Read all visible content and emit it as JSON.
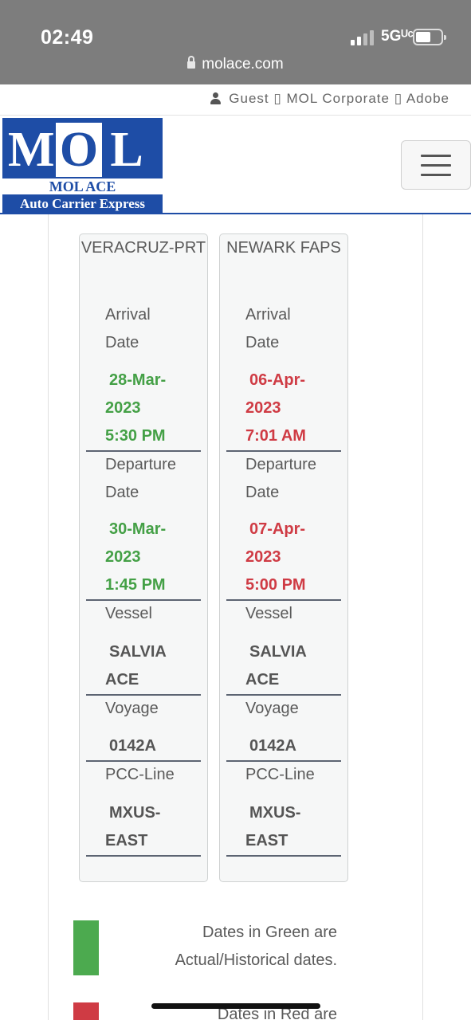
{
  "status_bar": {
    "time": "02:49",
    "network": "5Gᵁᶜ",
    "url": "molace.com"
  },
  "top_links": {
    "text": "Guest ▯ MOL Corporate ▯ Adobe"
  },
  "logo": {
    "letters": [
      "M",
      "O",
      "L"
    ],
    "subtitle": "MOL ACE",
    "tagline": "Auto Carrier Express",
    "brand_color": "#1e4da6"
  },
  "ports": [
    {
      "name": "VERACRUZ-PRT",
      "arrival_label": "Arrival Date",
      "arrival": [
        "28-Mar-",
        "2023",
        "5:30 PM"
      ],
      "arrival_color": "green",
      "departure_label": "Departure Date",
      "departure": [
        "30-Mar-",
        "2023",
        "1:45 PM"
      ],
      "departure_color": "green",
      "vessel_label": "Vessel",
      "vessel": [
        "SALVIA",
        "ACE"
      ],
      "voyage_label": "Voyage",
      "voyage": "0142A",
      "pcc_label": "PCC-Line",
      "pcc": [
        "MXUS-",
        "EAST"
      ]
    },
    {
      "name": "NEWARK FAPS",
      "arrival_label": "Arrival Date",
      "arrival": [
        "06-Apr-",
        "2023",
        "7:01 AM"
      ],
      "arrival_color": "red",
      "departure_label": "Departure Date",
      "departure": [
        "07-Apr-",
        "2023",
        "5:00 PM"
      ],
      "departure_color": "red",
      "vessel_label": "Vessel",
      "vessel": [
        "SALVIA",
        "ACE"
      ],
      "voyage_label": "Voyage",
      "voyage": "0142A",
      "pcc_label": "PCC-Line",
      "pcc": [
        "MXUS-",
        "EAST"
      ]
    }
  ],
  "legend": [
    {
      "lines": [
        "Dates in Green are",
        "Actual/Historical dates."
      ],
      "color": "#4caa4f"
    },
    {
      "lines": [
        "Dates in Red are"
      ],
      "color": "#cf3b44"
    }
  ]
}
